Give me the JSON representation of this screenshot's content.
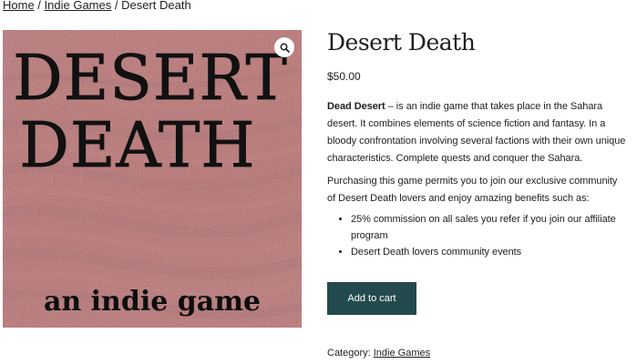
{
  "breadcrumb": {
    "home": "Home",
    "sep1": " / ",
    "category": "Indie Games",
    "sep2": " / ",
    "current": "Desert Death"
  },
  "product": {
    "title": "Desert Death",
    "price": "$50.00",
    "image": {
      "line1": "DESERT",
      "line2": "DEATH",
      "tagline": "an indie game"
    },
    "zoom_icon": "magnifier-icon",
    "description": {
      "lead_bold": "Dead Desert",
      "lead_text": " – is an indie game that takes place in the Sahara desert. It combines elements of science fiction and fantasy. In a bloody confrontation involving several factions with their own unique characteristics. Complete quests and conquer the Sahara.",
      "paragraph2": "Purchasing this game permits you to join our exclusive community of Desert Death lovers and  enjoy amazing benefits such as:",
      "benefits": [
        "25% commission on all sales you refer if you join our affiliate program",
        "Desert Death lovers community events"
      ]
    },
    "add_to_cart_label": "Add to cart",
    "category_label": "Category: ",
    "category_link": "Indie Games"
  },
  "colors": {
    "button_bg": "#234a4c",
    "text": "#1e1e1e",
    "sand_light": "#d98f8a",
    "sand_dark": "#7a3a4e"
  }
}
